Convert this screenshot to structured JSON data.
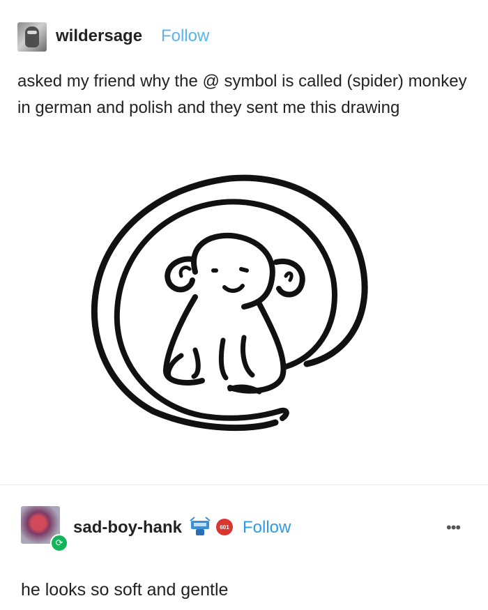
{
  "original_post": {
    "username": "wildersage",
    "follow_label": "Follow",
    "text": "asked my friend why the @ symbol is called (spider) monkey in german and polish and they sent me this drawing",
    "image_alt": "drawing of a monkey shaped like an @ symbol"
  },
  "reblog": {
    "username": "sad-boy-hank",
    "follow_label": "Follow",
    "badge_text": "601",
    "more_label": "•••",
    "text": "he looks so soft and gentle"
  },
  "colors": {
    "follow_original": "#5ab4ec",
    "follow_reblog": "#2f9be6",
    "reblog_badge": "#12b55a"
  }
}
